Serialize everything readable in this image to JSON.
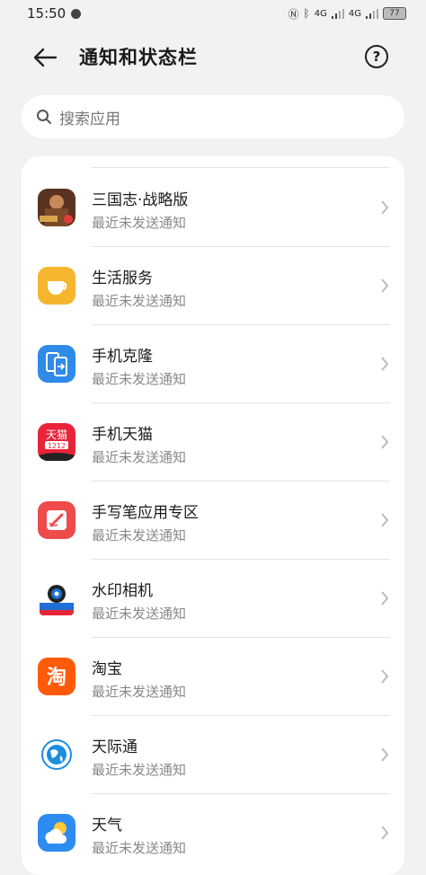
{
  "status_bar": {
    "time": "15:50",
    "signal1": "4G",
    "signal2": "4G",
    "battery": "77"
  },
  "header": {
    "title": "通知和状态栏",
    "help_label": "?"
  },
  "search": {
    "placeholder": "搜索应用"
  },
  "apps": [
    {
      "name": "三国志·战略版",
      "status": "最近未发送通知",
      "icon": "sanguozhi-game-icon",
      "color": "#6b3a22"
    },
    {
      "name": "生活服务",
      "status": "最近未发送通知",
      "icon": "cup-icon",
      "color": "#f5b52e"
    },
    {
      "name": "手机克隆",
      "status": "最近未发送通知",
      "icon": "phone-clone-icon",
      "color": "#2f8ae8"
    },
    {
      "name": "手机天猫",
      "status": "最近未发送通知",
      "icon": "tmall-icon",
      "color": "#e8243a"
    },
    {
      "name": "手写笔应用专区",
      "status": "最近未发送通知",
      "icon": "pen-icon",
      "color": "#ee4b4b"
    },
    {
      "name": "水印相机",
      "status": "最近未发送通知",
      "icon": "camera-icon",
      "color": "#1f6fd6"
    },
    {
      "name": "淘宝",
      "status": "最近未发送通知",
      "icon": "taobao-icon",
      "color": "#ff5a0a"
    },
    {
      "name": "天际通",
      "status": "最近未发送通知",
      "icon": "globe-icon",
      "color": "#1b8fe0"
    },
    {
      "name": "天气",
      "status": "最近未发送通知",
      "icon": "weather-icon",
      "color": "#2e8cf0"
    }
  ],
  "icon_texts": {
    "tmall": "天猫",
    "tmall_date": "1212",
    "taobao": "淘"
  }
}
